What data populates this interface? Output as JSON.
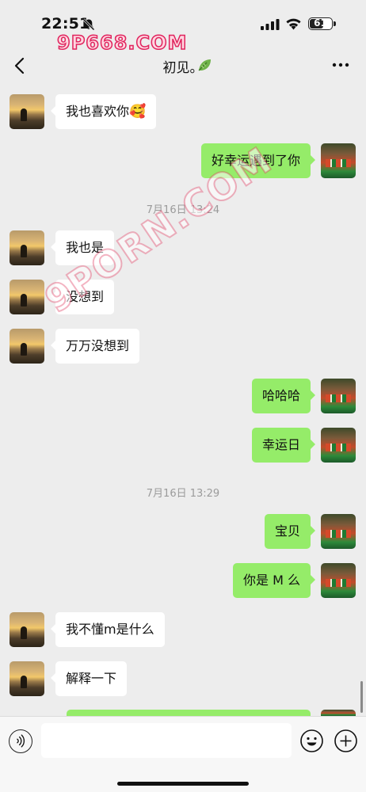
{
  "status_bar": {
    "time": "22:51",
    "battery": "61",
    "icons": [
      "bell-off-icon",
      "signal-icon",
      "wifi-icon",
      "battery-icon"
    ]
  },
  "watermarks": {
    "top": "9P668.COM",
    "diagonal": "9PORN.COM"
  },
  "nav": {
    "back_icon": "chevron-left-icon",
    "title": "初见。",
    "title_icon": "leaf-icon",
    "more_icon": "more-dots-icon"
  },
  "messages": [
    {
      "side": "in",
      "text": "我也喜欢你",
      "emoji": "🥰"
    },
    {
      "side": "out",
      "text": "好幸运遇到了你"
    },
    {
      "type": "time",
      "text": "7月16日 13:24"
    },
    {
      "side": "in",
      "text": "我也是"
    },
    {
      "side": "in",
      "text": "没想到"
    },
    {
      "side": "in",
      "text": "万万没想到"
    },
    {
      "side": "out",
      "text": "哈哈哈"
    },
    {
      "side": "out",
      "text": "幸运日"
    },
    {
      "type": "time",
      "text": "7月16日 13:29"
    },
    {
      "side": "out",
      "text": "宝贝"
    },
    {
      "side": "out",
      "text": "你是 M 么"
    },
    {
      "side": "in",
      "text": "我不懂m是什么"
    },
    {
      "side": "in",
      "text": "解释一下"
    }
  ],
  "input_bar": {
    "voice_icon": "voice-icon",
    "input_value": "",
    "emoji_icon": "emoji-icon",
    "plus_icon": "plus-icon"
  },
  "colors": {
    "background": "#ededed",
    "bubble_out": "#95ec69",
    "bubble_in": "#ffffff",
    "timestamp": "#9b9b9b"
  }
}
